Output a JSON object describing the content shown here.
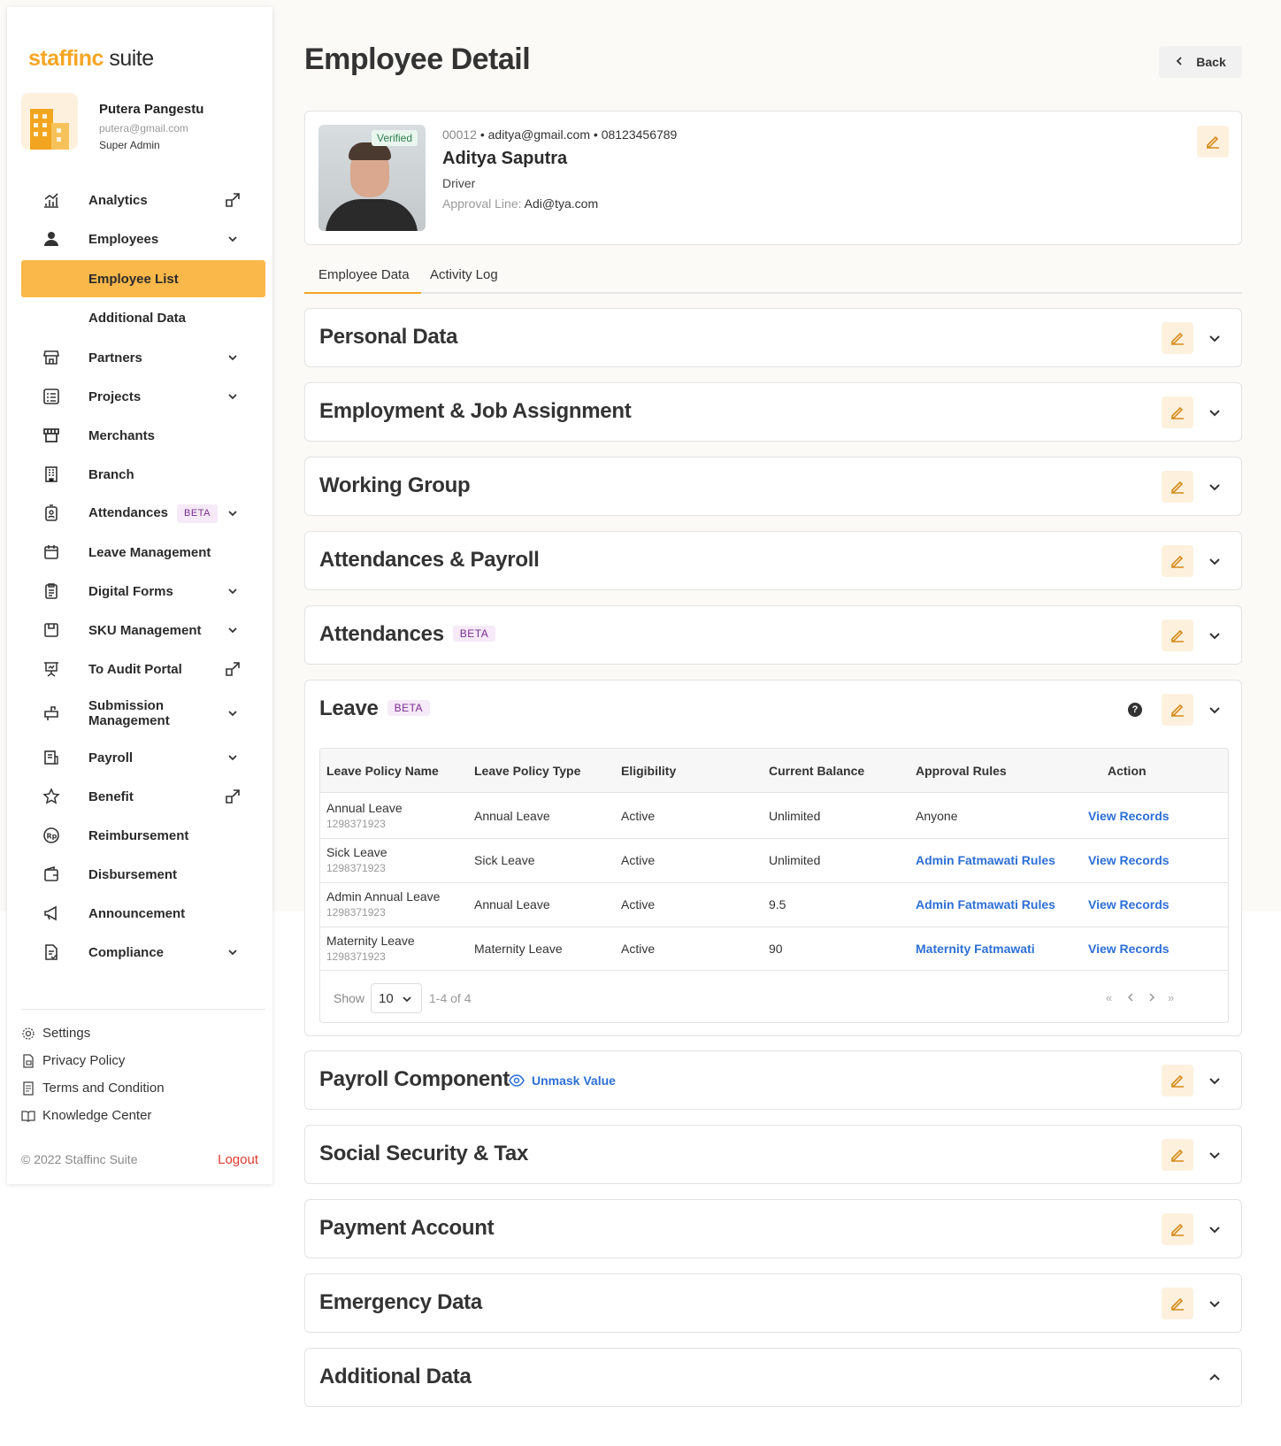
{
  "brand": {
    "logo_part1": "staffinc",
    "logo_part2": " suite"
  },
  "user": {
    "name": "Putera Pangestu",
    "email": "putera@gmail.com",
    "role": "Super Admin"
  },
  "nav": {
    "analytics": "Analytics",
    "employees": "Employees",
    "employee_list": "Employee List",
    "additional_data": "Additional Data",
    "partners": "Partners",
    "projects": "Projects",
    "merchants": "Merchants",
    "branch": "Branch",
    "attendances": "Attendances",
    "attendances_badge": "BETA",
    "leave_management": "Leave Management",
    "digital_forms": "Digital Forms",
    "sku_management": "SKU Management",
    "to_audit_portal": "To Audit Portal",
    "submission_management": "Submission Management",
    "payroll": "Payroll",
    "benefit": "Benefit",
    "reimbursement": "Reimbursement",
    "disbursement": "Disbursement",
    "announcement": "Announcement",
    "compliance": "Compliance"
  },
  "side_links": {
    "settings": "Settings",
    "privacy": "Privacy Policy",
    "terms": "Terms and Condition",
    "knowledge": "Knowledge Center",
    "copyright": "© 2022 Staffinc Suite",
    "logout": "Logout"
  },
  "header": {
    "title": "Employee Detail",
    "back": "Back"
  },
  "employee": {
    "verified": "Verified",
    "id": "00012",
    "email": "aditya@gmail.com",
    "phone": "08123456789",
    "name": "Aditya Saputra",
    "position": "Driver",
    "approval_label": "Approval Line:",
    "approval_value": "Adi@tya.com"
  },
  "tabs": [
    "Employee Data",
    "Activity Log"
  ],
  "sections": {
    "personal": "Personal Data",
    "employment": "Employment & Job Assignment",
    "working_group": "Working Group",
    "att_payroll": "Attendances & Payroll",
    "attendances": "Attendances",
    "attendances_badge": "BETA",
    "leave": "Leave",
    "leave_badge": "BETA",
    "payroll_component": "Payroll Component",
    "unmask": "Unmask Value",
    "social": "Social Security & Tax",
    "payment": "Payment Account",
    "emergency": "Emergency Data",
    "additional": "Additional Data"
  },
  "leave_table": {
    "headers": [
      "Leave Policy Name",
      "Leave Policy Type",
      "Eligibility",
      "Current Balance",
      "Approval Rules",
      "Action"
    ],
    "rows": [
      {
        "name": "Annual Leave",
        "code": "1298371923",
        "type": "Annual Leave",
        "eligibility": "Active",
        "balance": "Unlimited",
        "rule": "Anyone",
        "action": "View Records"
      },
      {
        "name": "Sick Leave",
        "code": "1298371923",
        "type": "Sick Leave",
        "eligibility": "Active",
        "balance": "Unlimited",
        "rule": "Admin Fatmawati Rules",
        "action": "View Records"
      },
      {
        "name": "Admin Annual Leave",
        "code": "1298371923",
        "type": "Annual Leave",
        "eligibility": "Active",
        "balance": "9.5",
        "rule": "Admin Fatmawati Rules",
        "action": "View Records"
      },
      {
        "name": "Maternity Leave",
        "code": "1298371923",
        "type": "Maternity Leave",
        "eligibility": "Active",
        "balance": "90",
        "rule": "Maternity Fatmawati",
        "action": "View Records"
      }
    ],
    "show_label": "Show",
    "page_size": "10",
    "range": "1-4 of 4"
  },
  "colors": {
    "accent": "#fbb84a",
    "link": "#2d6fd6",
    "logout": "#e03a2f"
  }
}
